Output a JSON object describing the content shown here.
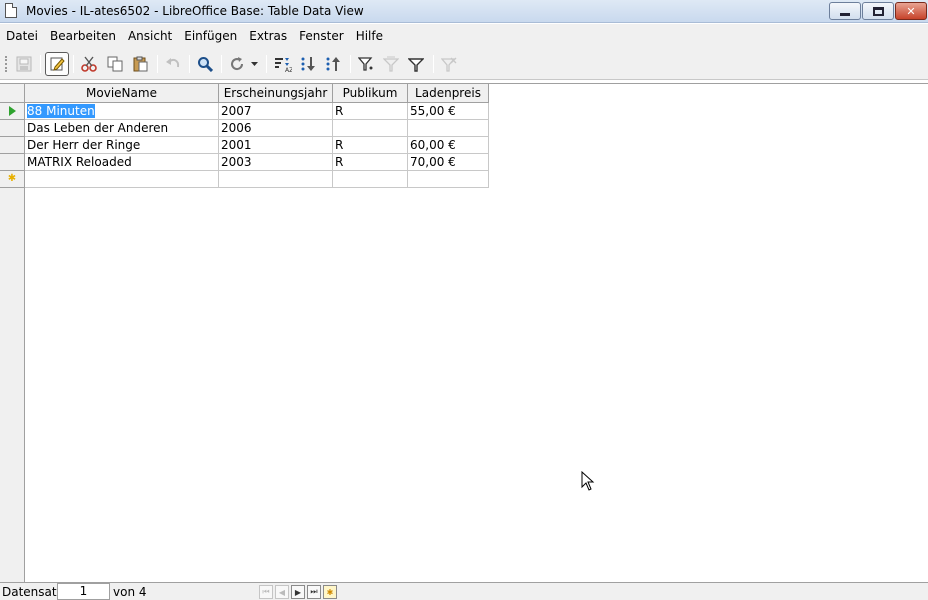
{
  "window": {
    "title": "Movies - IL-ates6502 - LibreOffice Base: Table Data View",
    "minimize_label": "—",
    "close_label": "✕"
  },
  "menu": {
    "items": [
      "Datei",
      "Bearbeiten",
      "Ansicht",
      "Einfügen",
      "Extras",
      "Fenster",
      "Hilfe"
    ]
  },
  "toolbar": {
    "buttons": [
      {
        "icon": "save-record-icon",
        "state": "disabled"
      },
      {
        "icon": "edit-data-icon",
        "state": "active"
      },
      {
        "icon": "cut-icon",
        "state": "normal"
      },
      {
        "icon": "copy-icon",
        "state": "normal"
      },
      {
        "icon": "paste-icon",
        "state": "normal"
      },
      {
        "icon": "undo-icon",
        "state": "disabled"
      },
      {
        "icon": "find-record-icon",
        "state": "normal"
      },
      {
        "icon": "refresh-icon",
        "state": "normal"
      },
      {
        "icon": "sort-icon",
        "state": "normal"
      },
      {
        "icon": "sort-ascending-icon",
        "state": "normal"
      },
      {
        "icon": "sort-descending-icon",
        "state": "normal"
      },
      {
        "icon": "autofilter-icon",
        "state": "normal"
      },
      {
        "icon": "apply-filter-icon",
        "state": "disabled"
      },
      {
        "icon": "standard-filter-icon",
        "state": "normal"
      },
      {
        "icon": "reset-filter-icon",
        "state": "disabled"
      }
    ]
  },
  "table": {
    "columns": [
      "MovieName",
      "Erscheinungsjahr",
      "Publikum",
      "Ladenpreis"
    ],
    "rows": [
      [
        "88 Minuten",
        "2007",
        "R",
        "55,00 €"
      ],
      [
        "Das Leben der Anderen",
        "2006",
        "",
        ""
      ],
      [
        "Der Herr der Ringe",
        "2001",
        "R",
        "60,00 €"
      ],
      [
        "MATRIX Reloaded",
        "2003",
        "R",
        "70,00 €"
      ]
    ],
    "current_row": 0,
    "selected_cell_text": "88 Minuten"
  },
  "navigation": {
    "record_label": "Datensatz",
    "current_record": "1",
    "of_total": "von 4"
  }
}
